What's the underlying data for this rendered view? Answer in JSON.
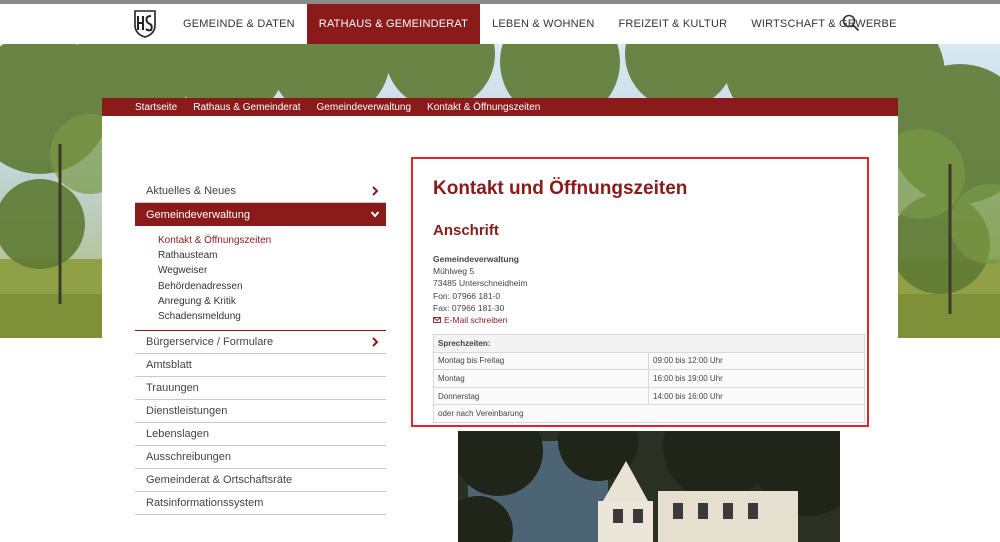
{
  "header": {
    "nav": [
      {
        "label": "GEMEINDE & DATEN",
        "active": false
      },
      {
        "label": "RATHAUS & GEMEINDERAT",
        "active": true
      },
      {
        "label": "LEBEN & WOHNEN",
        "active": false
      },
      {
        "label": "FREIZEIT & KULTUR",
        "active": false
      },
      {
        "label": "WIRTSCHAFT & GEWERBE",
        "active": false
      }
    ]
  },
  "breadcrumb": [
    "Startseite",
    "Rathaus & Gemeinderat",
    "Gemeindeverwaltung",
    "Kontakt & Öffnungszeiten"
  ],
  "sidebar": {
    "top_items": [
      {
        "label": "Aktuelles & Neues"
      }
    ],
    "active": {
      "label": "Gemeindeverwaltung"
    },
    "submenu": [
      {
        "label": "Kontakt & Öffnungszeiten"
      },
      {
        "label": "Rathausteam"
      },
      {
        "label": "Wegweiser"
      },
      {
        "label": "Behördenadressen"
      },
      {
        "label": "Anregung & Kritik"
      },
      {
        "label": "Schadensmeldung"
      }
    ],
    "items": [
      {
        "label": "Bürgerservice / Formulare"
      },
      {
        "label": "Amtsblatt"
      },
      {
        "label": "Trauungen"
      },
      {
        "label": "Dienstleistungen"
      },
      {
        "label": "Lebenslagen"
      },
      {
        "label": "Ausschreibungen"
      },
      {
        "label": "Gemeinderat & Ortschaftsräte"
      },
      {
        "label": "Ratsinformationssystem"
      }
    ]
  },
  "main": {
    "title": "Kontakt und Öffnungszeiten",
    "subtitle": "Anschrift",
    "address": {
      "org": "Gemeindeverwaltung",
      "street": "Mühlweg 5",
      "city": "73485 Unterschneidheim",
      "phone": "Fon: 07966 181-0",
      "fax": "Fax: 07966 181-30",
      "email_link": "E-Mail schreiben"
    },
    "hours": {
      "header": "Sprechzeiten:",
      "rows": [
        {
          "day": "Montag bis Freitag",
          "time": "09:00 bis 12:00 Uhr"
        },
        {
          "day": "Montag",
          "time": "16:00 bis 19:00 Uhr"
        },
        {
          "day": "Donnerstag",
          "time": "14:00 bis 16:00 Uhr"
        }
      ],
      "footer": "oder nach Vereinbarung"
    }
  },
  "colors": {
    "brand": "#8b1a1a",
    "highlight": "#e0242b"
  }
}
